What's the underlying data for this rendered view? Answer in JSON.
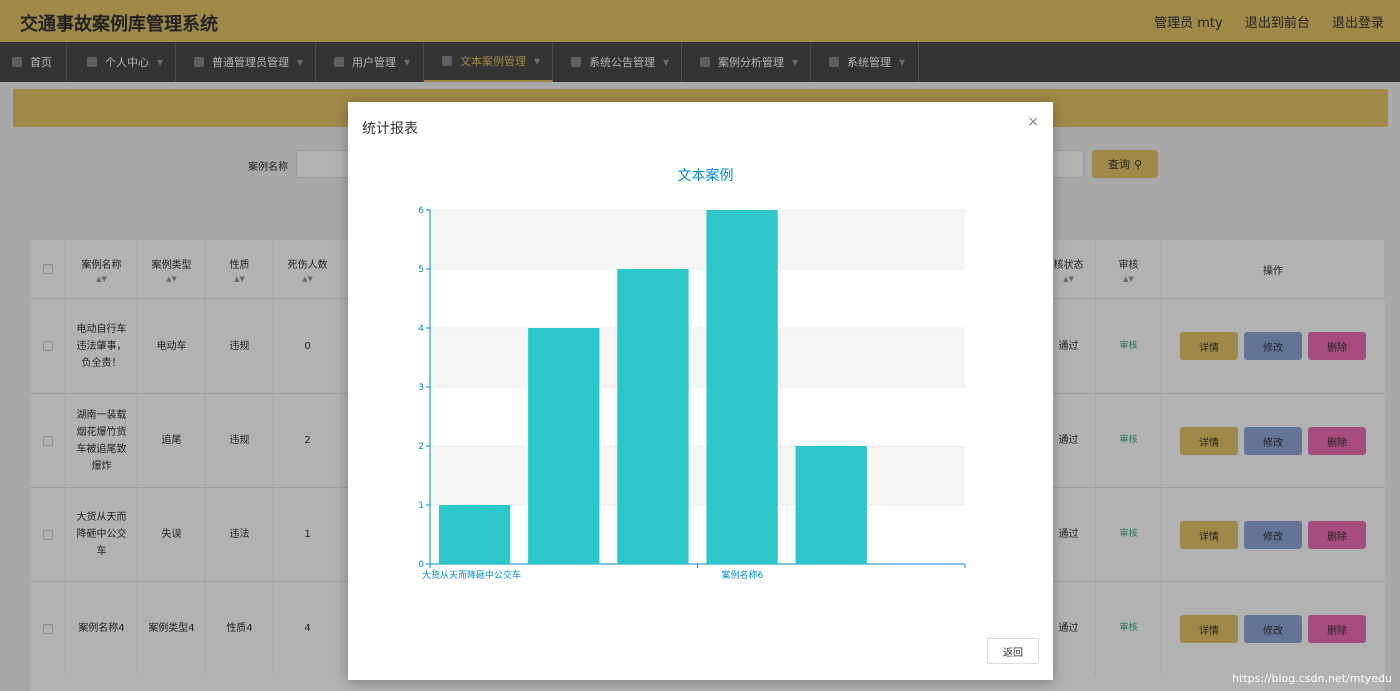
{
  "header": {
    "title": "交通事故案例库管理系统",
    "user": "管理员 mty",
    "exit_front": "退出到前台",
    "logout": "退出登录"
  },
  "nav": [
    {
      "label": "首页",
      "icon": "home-icon"
    },
    {
      "label": "个人中心",
      "icon": "user-icon"
    },
    {
      "label": "普通管理员管理",
      "icon": "card-icon"
    },
    {
      "label": "用户管理",
      "icon": "user-icon"
    },
    {
      "label": "文本案例管理",
      "icon": "phone-icon",
      "active": true
    },
    {
      "label": "系统公告管理",
      "icon": "power-icon"
    },
    {
      "label": "案例分析管理",
      "icon": "copy-icon"
    },
    {
      "label": "系统管理",
      "icon": "checkbox-icon"
    }
  ],
  "search": {
    "label": "案例名称",
    "button": "查询"
  },
  "table": {
    "headers": [
      "案例名称",
      "案例类型",
      "性质",
      "死伤人数",
      "核状态",
      "审核",
      "操作"
    ],
    "rows": [
      {
        "name": "电动自行车违法肇事，负全责！",
        "type": "电动车",
        "nature": "违规",
        "casualties": "0",
        "status": "通过",
        "audit": "审核"
      },
      {
        "name": "湖南一装载烟花爆竹货车被追尾致爆炸",
        "type": "追尾",
        "nature": "违规",
        "casualties": "2",
        "status": "通过",
        "audit": "审核"
      },
      {
        "name": "大货从天而降砸中公交车",
        "type": "失误",
        "nature": "违法",
        "casualties": "1",
        "status": "通过",
        "audit": "审核"
      },
      {
        "name": "案例名称4",
        "type": "案例类型4",
        "nature": "性质4",
        "casualties": "4",
        "status": "通过",
        "audit": "审核"
      }
    ],
    "ops": {
      "detail": "详情",
      "edit": "修改",
      "delete": "删除"
    }
  },
  "dialog": {
    "title": "统计报表",
    "close": "×",
    "back": "返回"
  },
  "chart_data": {
    "type": "bar",
    "title": "文本案例",
    "categories": [
      "大货从天而降砸中公交车",
      "",
      "",
      "案例名称6",
      ""
    ],
    "values": [
      1,
      4,
      5,
      6,
      2
    ],
    "ylim": [
      0,
      6
    ],
    "yticks": [
      0,
      1,
      2,
      3,
      4,
      5,
      6
    ],
    "grid": true,
    "colors": {
      "bar": "#2ec7c9",
      "axis": "#008acd",
      "title": "#008acd"
    }
  },
  "watermark": "https://blog.csdn.net/mtyedu"
}
